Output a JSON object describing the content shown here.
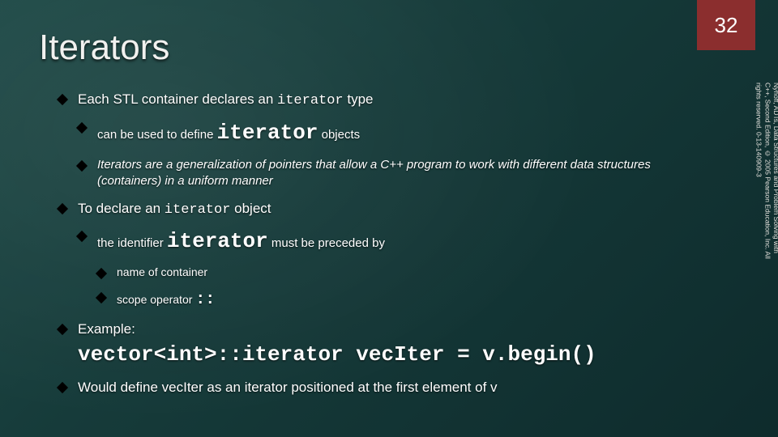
{
  "page_number": "32",
  "title": "Iterators",
  "b1": {
    "pre": "Each STL container declares an ",
    "code": "iterator",
    "post": " type",
    "s1": {
      "pre": "can be used to define ",
      "code": "iterator",
      "post": " objects"
    },
    "s2": "Iterators are a generalization of pointers that allow a C++ program to work with different data structures (containers) in a uniform manner"
  },
  "b2": {
    "pre": "To declare an ",
    "code": "iterator",
    "post": " object",
    "s1": {
      "pre": "the identifier ",
      "code": "iterator",
      "post": " must be preceded by"
    },
    "ss1": "name of container",
    "ss2": {
      "pre": "scope operator ",
      "code": "::"
    }
  },
  "b3": {
    "label": "Example:",
    "code": "vector<int>::iterator vecIter = v.begin()"
  },
  "b4": "Would define vecIter as an iterator positioned at the first element of v",
  "copyright": "Nyhoff, ADTs, Data Structures and Problem Solving with\nC++, Second Edition, © 2005 Pearson Education, Inc. All\nrights reserved. 0-13-140909-3"
}
